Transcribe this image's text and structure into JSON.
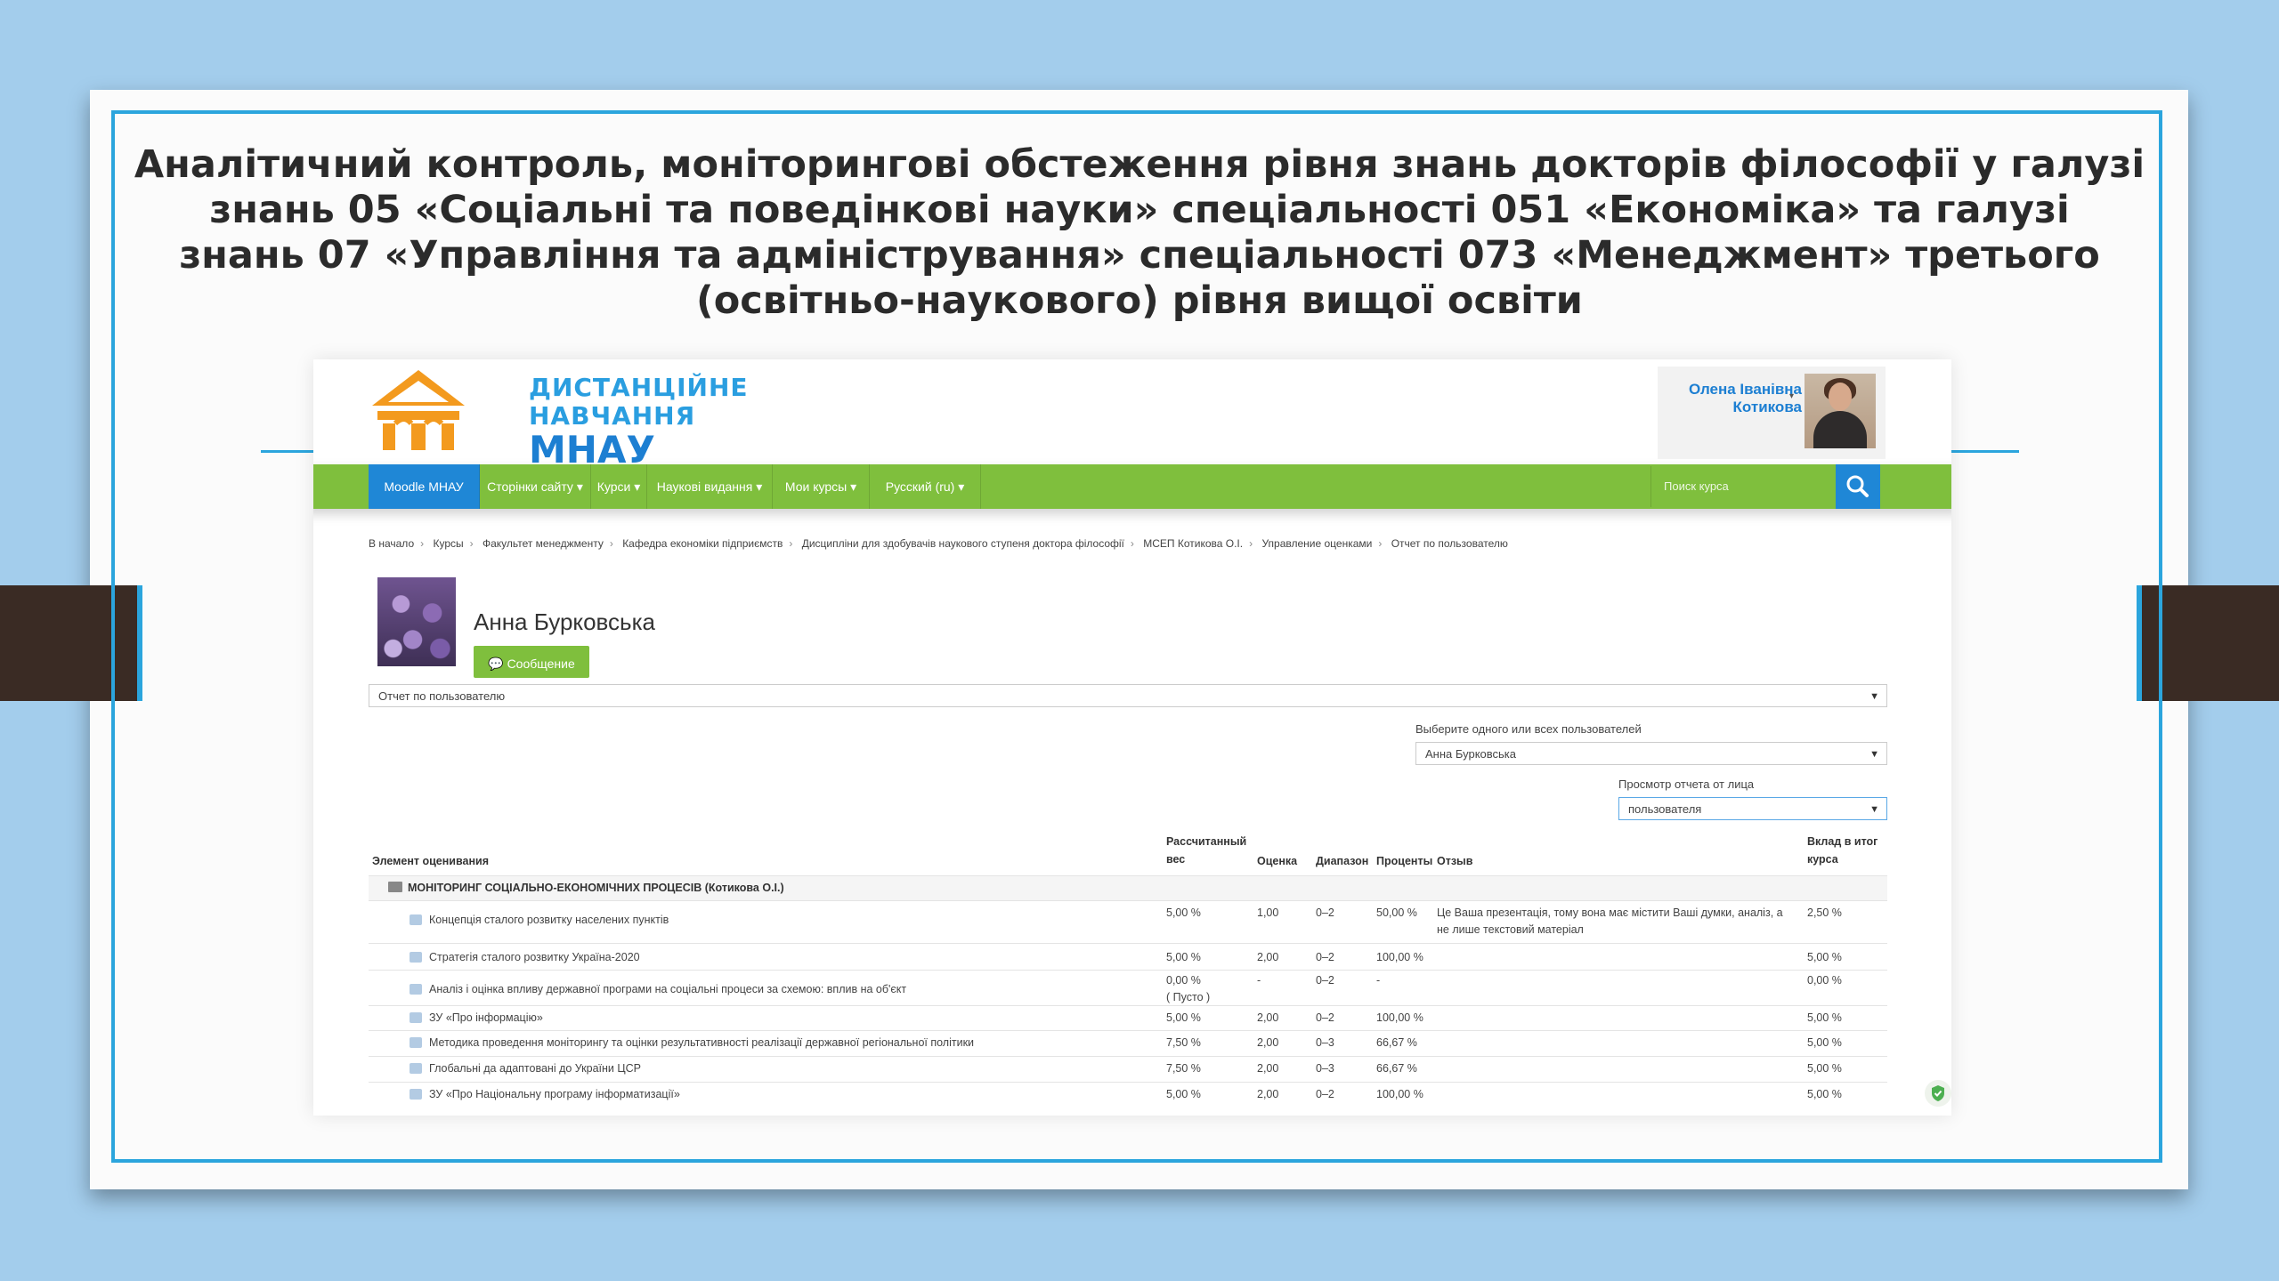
{
  "slide": {
    "title_lines": [
      "Аналітичний контроль, моніторингові обстеження рівня знань докторів філософії у галузі",
      "знань 05 «Соціальні та поведінкові науки» спеціальності 051 «Економіка» та галузі",
      "знань 07 «Управління та адміністрування» спеціальності 073 «Менеджмент» третього",
      "(освітньо-наукового) рівня вищої освіти"
    ]
  },
  "site": {
    "logo_lines": [
      "ДИСТАНЦІЙНЕ",
      "НАВЧАННЯ",
      "МНАУ"
    ],
    "user_name_lines": [
      "Олена Іванівна",
      "Котикова"
    ]
  },
  "nav": {
    "items": [
      "Moodle МНАУ",
      "Сторінки сайту",
      "Курси",
      "Наукові видання",
      "Мои курсы",
      "Русский (ru)"
    ],
    "search_placeholder": "Поиск курса"
  },
  "breadcrumb": [
    "В начало",
    "Курсы",
    "Факультет менеджменту",
    "Кафедра економіки підприємств",
    "Дисципліни для здобувачів наукового ступеня доктора філософії",
    "МСЕП Котикова О.І.",
    "Управление оценками",
    "Отчет по пользователю"
  ],
  "profile": {
    "name": "Анна Бурковська",
    "message_button": "Сообщение"
  },
  "controls": {
    "report_select": "Отчет по пользователю",
    "users_label": "Выберите одного или всех пользователей",
    "users_select": "Анна Бурковська",
    "view_label": "Просмотр отчета от лица",
    "view_select": "пользователя"
  },
  "table": {
    "headers": {
      "item": "Элемент оценивания",
      "weight_1": "Рассчитанный",
      "weight_2": "вес",
      "grade": "Оценка",
      "range": "Диапазон",
      "percent": "Проценты",
      "feedback": "Отзыв",
      "contrib_1": "Вклад в итог",
      "contrib_2": "курса"
    },
    "category": "МОНІТОРИНГ СОЦІАЛЬНО-ЕКОНОМІЧНИХ ПРОЦЕСІВ (Котикова О.І.)",
    "rows": [
      {
        "name": "Концепція сталого розвитку населених пунктів",
        "weight": "5,00 %",
        "grade": "1,00",
        "range": "0–2",
        "percent": "50,00 %",
        "feedback_1": "Це Ваша презентація, тому вона має містити Ваші думки, аналіз, а",
        "feedback_2": "не лише текстовий матеріал",
        "contrib": "2,50 %"
      },
      {
        "name": "Стратегія сталого розвитку Україна-2020",
        "weight": "5,00 %",
        "grade": "2,00",
        "range": "0–2",
        "percent": "100,00 %",
        "feedback_1": "",
        "feedback_2": "",
        "contrib": "5,00 %"
      },
      {
        "name": "Аналіз і оцінка впливу державної програми на соціальні процеси за схемою: вплив на об'єкт",
        "weight": "0,00 %",
        "weight_note": "( Пусто )",
        "grade": "-",
        "range": "0–2",
        "percent": "-",
        "feedback_1": "",
        "feedback_2": "",
        "contrib": "0,00 %"
      },
      {
        "name": "ЗУ «Про інформацію»",
        "weight": "5,00 %",
        "grade": "2,00",
        "range": "0–2",
        "percent": "100,00 %",
        "feedback_1": "",
        "feedback_2": "",
        "contrib": "5,00 %"
      },
      {
        "name": "Методика проведення моніторингу та оцінки результативності реалізації державної регіональної політики",
        "weight": "7,50 %",
        "grade": "2,00",
        "range": "0–3",
        "percent": "66,67 %",
        "feedback_1": "",
        "feedback_2": "",
        "contrib": "5,00 %"
      },
      {
        "name": "Глобальні да адаптовані до України ЦСР",
        "weight": "7,50 %",
        "grade": "2,00",
        "range": "0–3",
        "percent": "66,67 %",
        "feedback_1": "",
        "feedback_2": "",
        "contrib": "5,00 %"
      },
      {
        "name": "ЗУ «Про Національну програму інформатизації»",
        "weight": "5,00 %",
        "grade": "2,00",
        "range": "0–2",
        "percent": "100,00 %",
        "feedback_1": "",
        "feedback_2": "",
        "contrib": "5,00 %"
      }
    ]
  },
  "icons": {
    "logo": "house-cap-logo-icon",
    "search": "search-icon",
    "folder": "folder-icon",
    "grade_item": "assignment-icon",
    "security": "shield-icon"
  },
  "colors": {
    "background": "#a3cdec",
    "frame": "#2ba5dd",
    "nav_green": "#7fbf3d",
    "nav_blue": "#1f87d6",
    "logo_orange": "#f39a1e"
  }
}
